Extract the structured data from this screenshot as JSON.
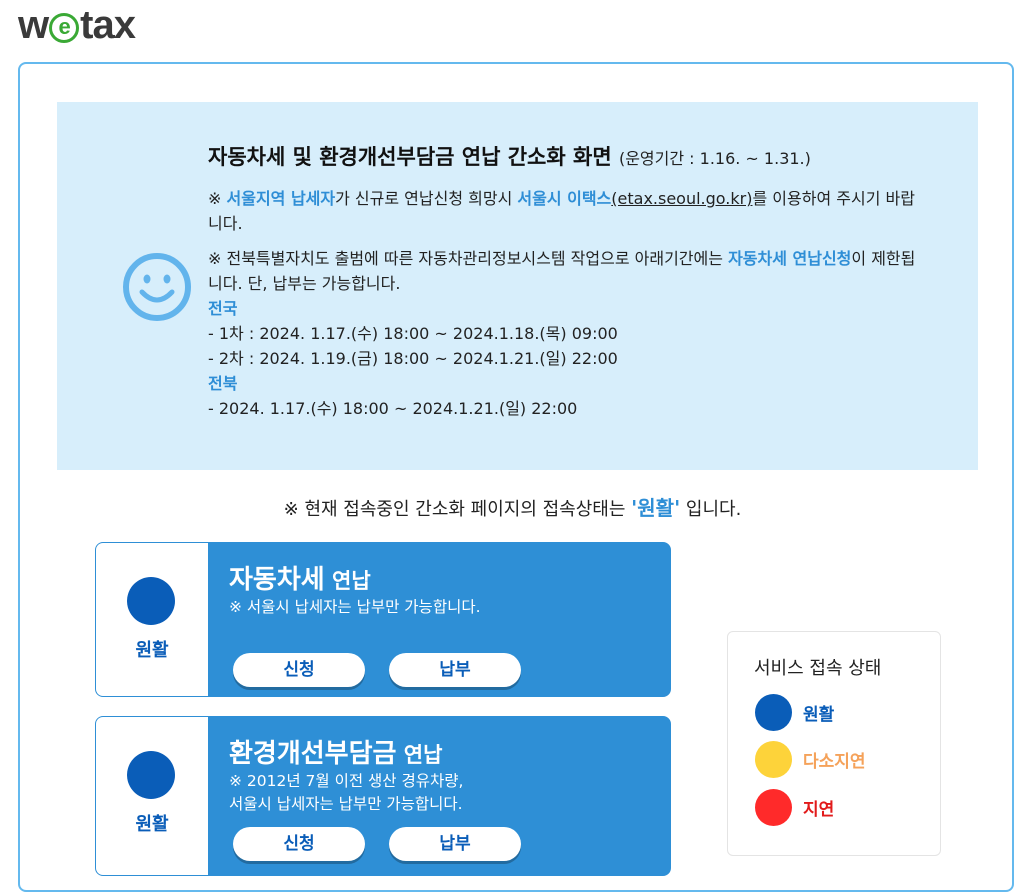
{
  "logo": {
    "pre": "w",
    "mid": "e",
    "post": "tax"
  },
  "notice": {
    "title": "자동차세 및 환경개선부담금 연납 간소화 화면",
    "period": "(운영기간 : 1.16. ~ 1.31.)",
    "p1_mark": "※ ",
    "p1_hl1": "서울지역 납세자",
    "p1_t1": "가 신규로 연납신청 희망시 ",
    "p1_hl2": "서울시 이택스",
    "p1_link": "(etax.seoul.go.kr)",
    "p1_t2": "를 이용하여 주시기 바랍니다.",
    "p2_t1": "※ 전북특별자치도 출범에 따른 자동차관리정보시스템 작업으로 아래기간에는 ",
    "p2_hl": "자동차세 연납신청",
    "p2_t2": "이 제한됩니다. 단, 납부는 가능합니다.",
    "nat_label": "전국",
    "nat_line1": "- 1차 : 2024. 1.17.(수) 18:00 ~ 2024.1.18.(목) 09:00",
    "nat_line2": "- 2차 : 2024. 1.19.(금) 18:00 ~ 2024.1.21.(일) 22:00",
    "jb_label": "전북",
    "jb_line1": "- 2024. 1.17.(수) 18:00 ~ 2024.1.21.(일) 22:00"
  },
  "status_line": {
    "pre": "※ 현재 접속중인 간소화 페이지의 접속상태는 ",
    "value": "'원활'",
    "post": " 입니다."
  },
  "cards": [
    {
      "status": "원활",
      "title_main": "자동차세",
      "title_sub": " 연납",
      "desc": "※ 서울시 납세자는 납부만 가능합니다.",
      "apply_label": "신청",
      "pay_label": "납부"
    },
    {
      "status": "원활",
      "title_main": "환경개선부담금",
      "title_sub": " 연납",
      "desc_line1": "※ 2012년 7월 이전 생산 경유차량,",
      "desc_line2": "서울시 납세자는 납부만 가능합니다.",
      "apply_label": "신청",
      "pay_label": "납부"
    }
  ],
  "legend": {
    "title": "서비스 접속 상태",
    "items": [
      {
        "label": "원활",
        "color": "#0a5db8",
        "text_color": "#0a5db8"
      },
      {
        "label": "다소지연",
        "color": "#fdd33a",
        "text_color": "#f5a25a"
      },
      {
        "label": "지연",
        "color": "#ff2a2a",
        "text_color": "#e21b1b"
      }
    ]
  },
  "colors": {
    "accent": "#2e8fd6",
    "frame": "#64b9ee",
    "notice_bg": "#d7eefb"
  }
}
